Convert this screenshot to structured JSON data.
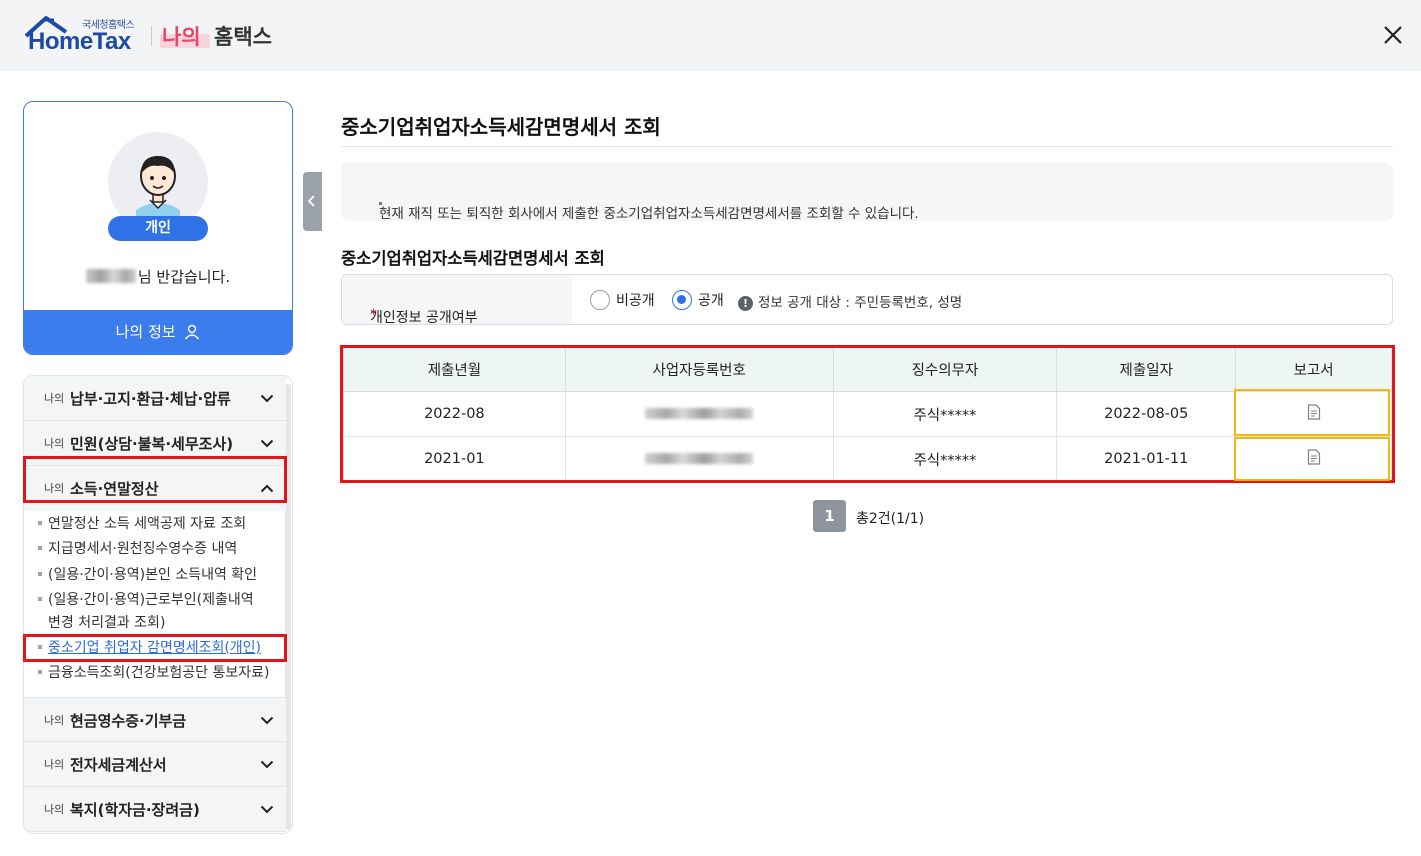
{
  "header": {
    "logo_small": "국세청홈택스",
    "logo_main": "HomeTax",
    "brand_my": "나의",
    "brand_hometax": "홈택스"
  },
  "profile": {
    "badge": "개인",
    "greeting_suffix": "님 반갑습니다.",
    "my_info_button": "나의 정보"
  },
  "menu": {
    "categories": [
      {
        "prefix": "나의",
        "label": "납부·고지·환급·체납·압류"
      },
      {
        "prefix": "나의",
        "label": "민원(상담·불복·세무조사)"
      },
      {
        "prefix": "나의",
        "label": "소득·연말정산"
      },
      {
        "prefix": "나의",
        "label": "현금영수증·기부금"
      },
      {
        "prefix": "나의",
        "label": "전자세금계산서"
      },
      {
        "prefix": "나의",
        "label": "복지(학자금·장려금)"
      }
    ],
    "sub_items": [
      "연말정산 소득 세액공제 자료 조회",
      "지급명세서·원천징수영수증 내역",
      "(일용·간이·용역)본인 소득내역 확인",
      "(일용·간이·용역)근로부인(제출내역 변경 처리결과 조회)",
      "중소기업 취업자 감면명세조회(개인)",
      "금융소득조회(건강보험공단 통보자료)"
    ]
  },
  "main": {
    "title": "중소기업취업자소득세감면명세서 조회",
    "notice": "현재 재직 또는 퇴직한 회사에서 제출한 중소기업취업자소득세감면명세서를 조회할 수 있습니다.",
    "section_title": "중소기업취업자소득세감면명세서 조회",
    "privacy": {
      "label": "개인정보 공개여부",
      "required_mark": "*",
      "option_private": "비공개",
      "option_public": "공개",
      "selected": "공개",
      "note": "정보 공개 대상 : 주민등록번호, 성명"
    },
    "table": {
      "headers": [
        "제출년월",
        "사업자등록번호",
        "징수의무자",
        "제출일자",
        "보고서"
      ],
      "rows": [
        {
          "month": "2022-08",
          "company": "주식*****",
          "date": "2022-08-05"
        },
        {
          "month": "2021-01",
          "company": "주식*****",
          "date": "2021-01-11"
        }
      ]
    },
    "pagination": {
      "current_page": "1",
      "total": "총2건(1/1)"
    }
  },
  "colors": {
    "accent": "#2f72e8",
    "highlight_red": "#e5141b",
    "highlight_orange": "#f5b70a"
  }
}
